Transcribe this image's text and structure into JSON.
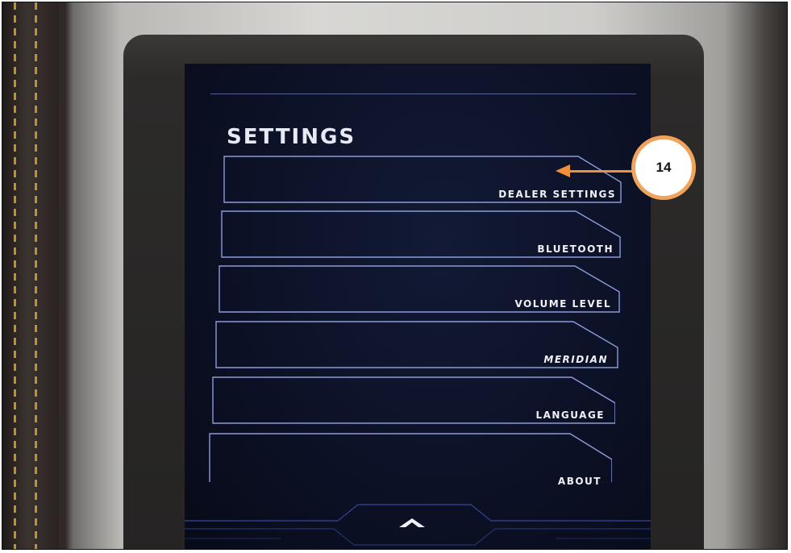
{
  "screen": {
    "title": "SETTINGS",
    "menu_items": [
      {
        "label": "DEALER SETTINGS"
      },
      {
        "label": "BLUETOOTH"
      },
      {
        "label": "VOLUME LEVEL"
      },
      {
        "label": "MERIDIAN"
      },
      {
        "label": "LANGUAGE"
      },
      {
        "label": "ABOUT"
      }
    ],
    "scroll_up_icon": "chevron-up-icon"
  },
  "annotation": {
    "callout_number": "14",
    "arrow_color": "#f0913a"
  },
  "colors": {
    "screen_bg": "#0c1126",
    "outline": "#8c9bd8",
    "text": "#f0f1f6",
    "callout_border": "#f0a35a"
  }
}
